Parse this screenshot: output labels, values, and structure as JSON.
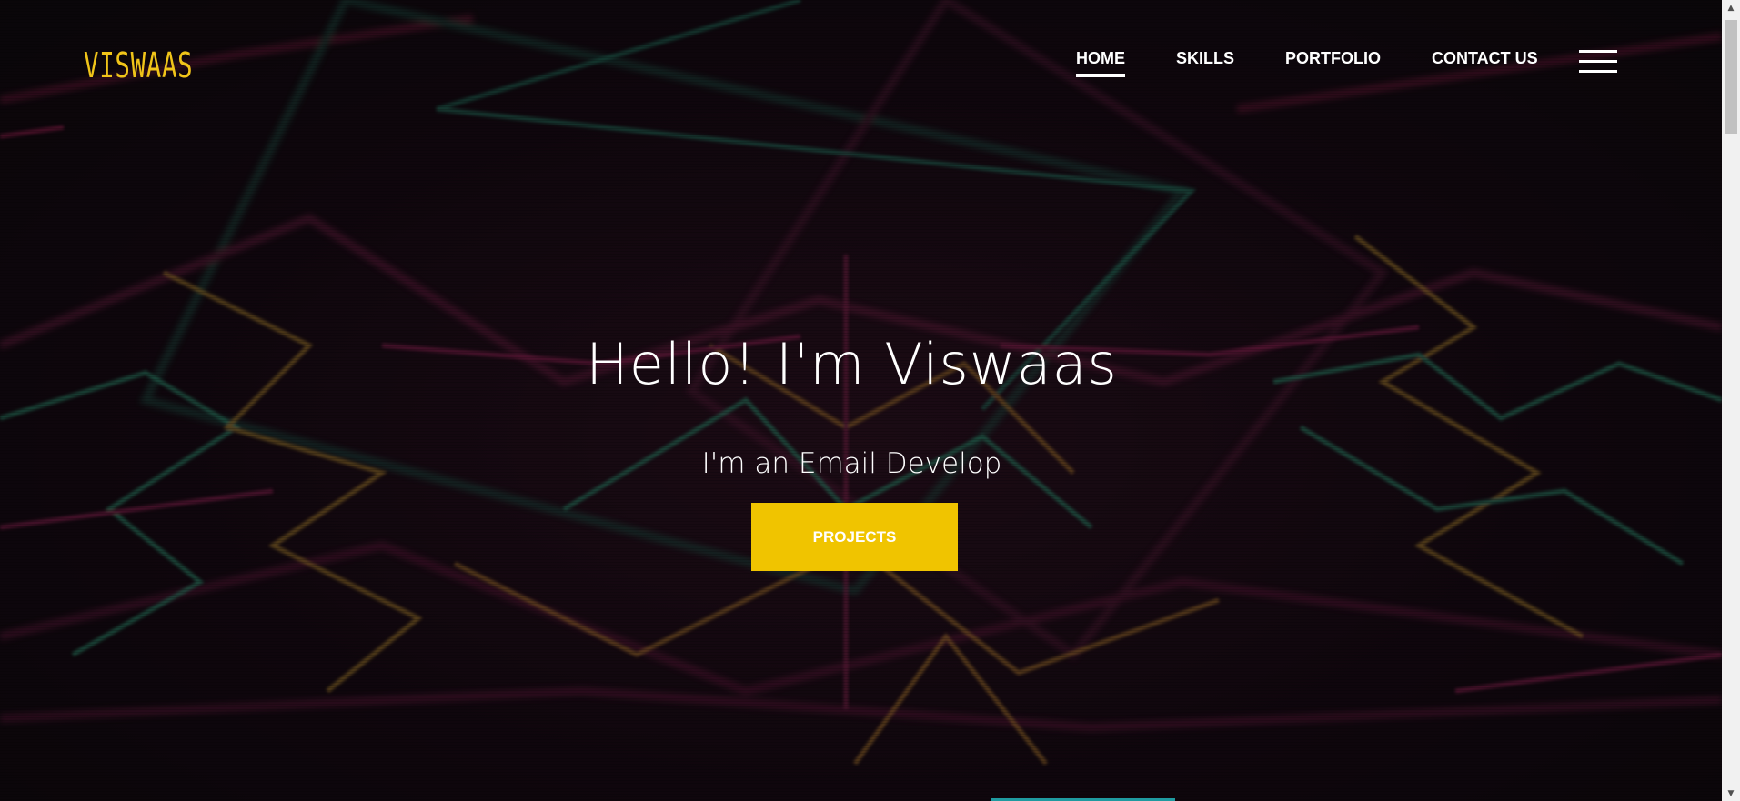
{
  "brand": {
    "logo_text": "VISWAAS",
    "accent_color": "#f0c419"
  },
  "nav": {
    "items": [
      {
        "label": "HOME",
        "active": true
      },
      {
        "label": "SKILLS",
        "active": false
      },
      {
        "label": "PORTFOLIO",
        "active": false
      },
      {
        "label": "CONTACT US",
        "active": false
      }
    ],
    "menu_icon": "hamburger-icon"
  },
  "hero": {
    "title": "Hello! I'm Viswaas",
    "subtitle": "I'm an Email Develop",
    "cta_label": "PROJECTS",
    "cta_color": "#f0c400",
    "background": "neon geometric lines"
  },
  "scrollbar": {
    "up_icon": "scroll-up-arrow-icon",
    "down_icon": "scroll-down-arrow-icon"
  }
}
